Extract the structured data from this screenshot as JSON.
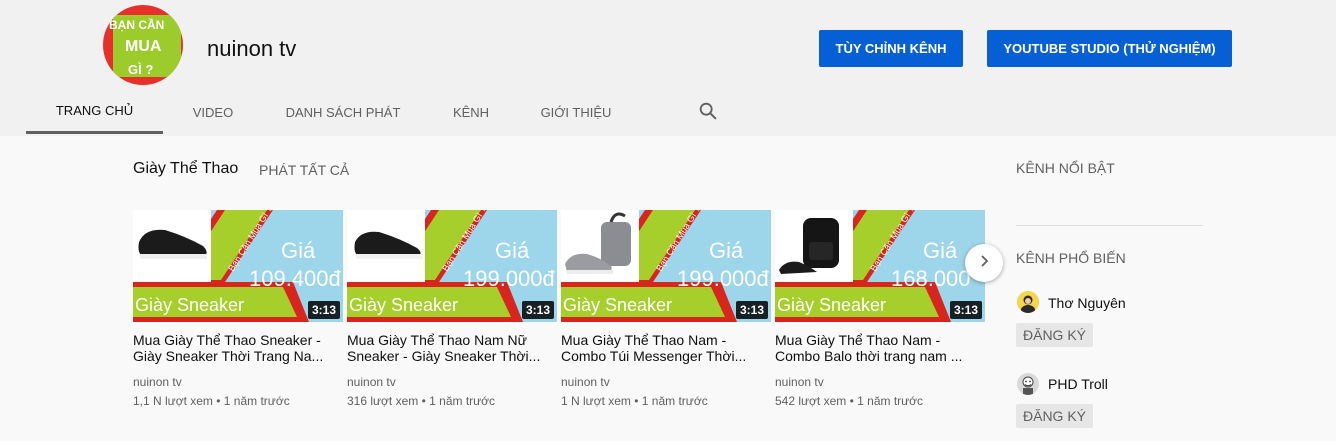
{
  "header": {
    "avatar_lines": [
      "BẠN CẦN",
      "MUA",
      "GÌ ?"
    ],
    "channel_name": "nuinon tv",
    "customize_button": "TÙY CHỈNH KÊNH",
    "studio_button": "YOUTUBE STUDIO (THỬ NGHIỆM)"
  },
  "tabs": [
    {
      "label": "TRANG CHỦ",
      "active": true
    },
    {
      "label": "VIDEO",
      "active": false
    },
    {
      "label": "DANH SÁCH PHÁT",
      "active": false
    },
    {
      "label": "KÊNH",
      "active": false
    },
    {
      "label": "GIỚI THIỆU",
      "active": false
    }
  ],
  "shelf": {
    "title": "Giày Thể Thao",
    "play_all": "PHÁT TẤT CẢ"
  },
  "videos": [
    {
      "title": "Mua Giày Thể Thao Sneaker - Giày Sneaker Thời Trang Na...",
      "channel": "nuinon tv",
      "meta": "1,1 N lượt xem • 1 năm trước",
      "duration": "3:13",
      "thumb_price_label": "Giá",
      "thumb_price": "109.400đ",
      "thumb_text": "Giày Sneaker",
      "thumb_tag": "Bạn Cần Mua Gì ?"
    },
    {
      "title": "Mua Giày Thể Thao Nam Nữ Sneaker - Giày Sneaker Thời...",
      "channel": "nuinon tv",
      "meta": "316 lượt xem • 1 năm trước",
      "duration": "3:13",
      "thumb_price_label": "Giá",
      "thumb_price": "199.000đ",
      "thumb_text": "Giày Sneaker",
      "thumb_tag": "Bạn Cần Mua Gì ?"
    },
    {
      "title": "Mua Giày Thể Thao Nam - Combo Túi Messenger Thời...",
      "channel": "nuinon tv",
      "meta": "1 N lượt xem • 1 năm trước",
      "duration": "3:13",
      "thumb_price_label": "Giá",
      "thumb_price": "199.000đ",
      "thumb_text": "Giày Sneaker",
      "thumb_tag": "Bạn Cần Mua Gì ?"
    },
    {
      "title": "Mua Giày Thể Thao Nam - Combo Balo thời trang nam ...",
      "channel": "nuinon tv",
      "meta": "542 lượt xem • 1 năm trước",
      "duration": "3:13",
      "thumb_price_label": "Giá",
      "thumb_price": "168.000",
      "thumb_text": "Giày Sneaker",
      "thumb_tag": "Bạn Cần Mua Gì ?"
    }
  ],
  "sidebar": {
    "featured_title": "KÊNH NỔI BẬT",
    "popular_title": "KÊNH PHỔ BIẾN",
    "channels": [
      {
        "name": "Thơ Nguyên",
        "subscribe": "ĐĂNG KÝ"
      },
      {
        "name": "PHD Troll",
        "subscribe": "ĐĂNG KÝ"
      }
    ]
  },
  "colors": {
    "accent_blue": "#065fd4",
    "thumb_red": "#d8261f",
    "thumb_green": "#a6cf2c",
    "thumb_sky": "#9dd5ea"
  },
  "icons": [
    "search-icon",
    "chevron-right-icon"
  ]
}
